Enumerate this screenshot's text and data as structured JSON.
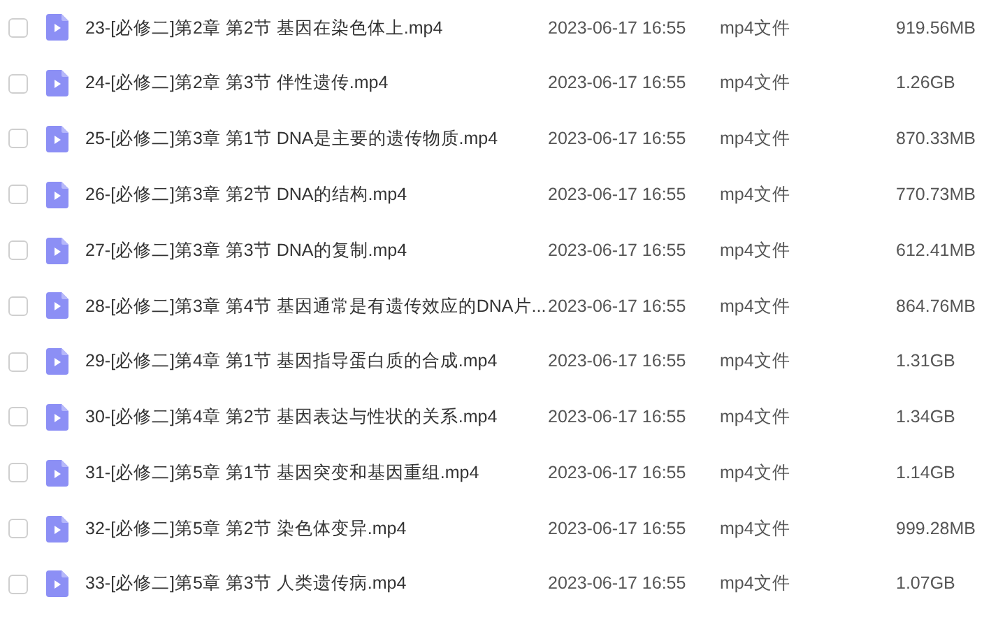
{
  "files": [
    {
      "name": "23-[必修二]第2章 第2节 基因在染色体上.mp4",
      "modified": "2023-06-17 16:55",
      "type": "mp4文件",
      "size": "919.56MB",
      "checked": false
    },
    {
      "name": "24-[必修二]第2章 第3节 伴性遗传.mp4",
      "modified": "2023-06-17 16:55",
      "type": "mp4文件",
      "size": "1.26GB",
      "checked": false
    },
    {
      "name": "25-[必修二]第3章 第1节 DNA是主要的遗传物质.mp4",
      "modified": "2023-06-17 16:55",
      "type": "mp4文件",
      "size": "870.33MB",
      "checked": false
    },
    {
      "name": "26-[必修二]第3章 第2节 DNA的结构.mp4",
      "modified": "2023-06-17 16:55",
      "type": "mp4文件",
      "size": "770.73MB",
      "checked": false
    },
    {
      "name": "27-[必修二]第3章 第3节 DNA的复制.mp4",
      "modified": "2023-06-17 16:55",
      "type": "mp4文件",
      "size": "612.41MB",
      "checked": false
    },
    {
      "name": "28-[必修二]第3章 第4节 基因通常是有遗传效应的DNA片...",
      "modified": "2023-06-17 16:55",
      "type": "mp4文件",
      "size": "864.76MB",
      "checked": false
    },
    {
      "name": "29-[必修二]第4章 第1节 基因指导蛋白质的合成.mp4",
      "modified": "2023-06-17 16:55",
      "type": "mp4文件",
      "size": "1.31GB",
      "checked": false
    },
    {
      "name": "30-[必修二]第4章 第2节 基因表达与性状的关系.mp4",
      "modified": "2023-06-17 16:55",
      "type": "mp4文件",
      "size": "1.34GB",
      "checked": false
    },
    {
      "name": "31-[必修二]第5章 第1节 基因突变和基因重组.mp4",
      "modified": "2023-06-17 16:55",
      "type": "mp4文件",
      "size": "1.14GB",
      "checked": false
    },
    {
      "name": "32-[必修二]第5章 第2节 染色体变异.mp4",
      "modified": "2023-06-17 16:55",
      "type": "mp4文件",
      "size": "999.28MB",
      "checked": false
    },
    {
      "name": "33-[必修二]第5章 第3节 人类遗传病.mp4",
      "modified": "2023-06-17 16:55",
      "type": "mp4文件",
      "size": "1.07GB",
      "checked": false
    }
  ]
}
